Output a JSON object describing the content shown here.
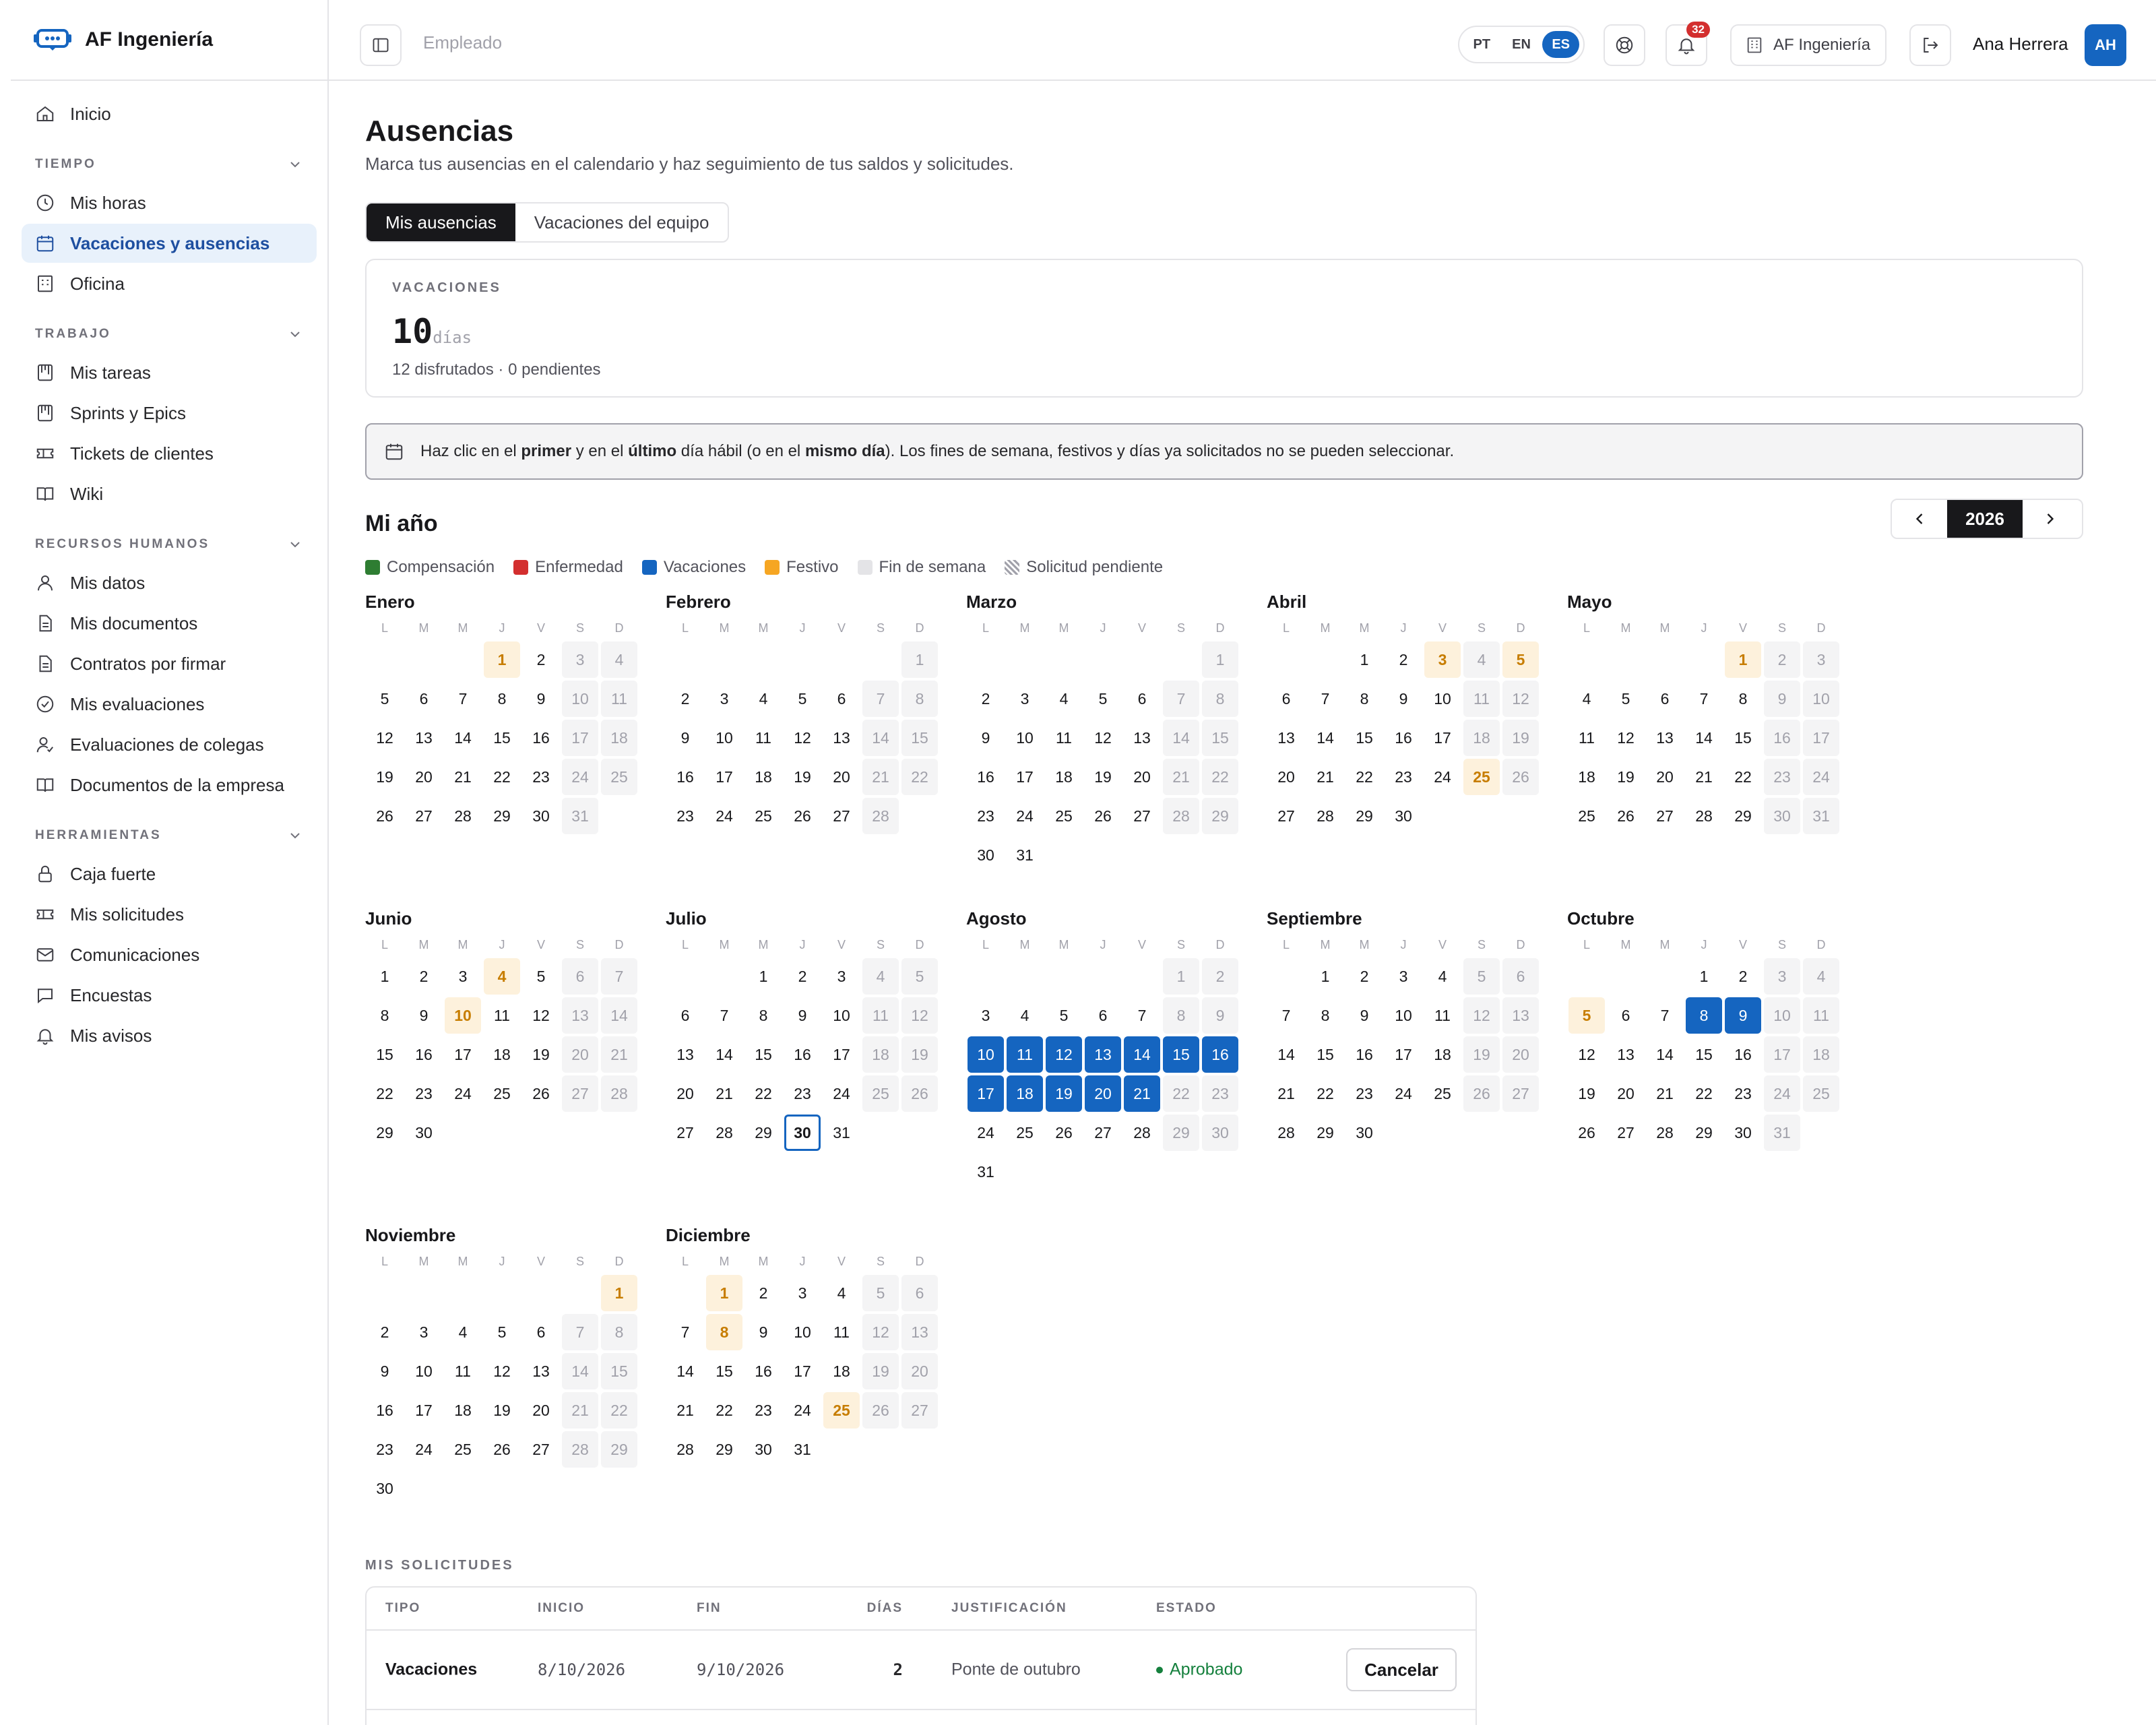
{
  "app": {
    "brand": "AF Ingeniería"
  },
  "sidebar": {
    "home": "Inicio",
    "sections": [
      {
        "title": "TIEMPO",
        "items": [
          "Mis horas",
          "Vacaciones y ausencias",
          "Oficina"
        ]
      },
      {
        "title": "TRABAJO",
        "items": [
          "Mis tareas",
          "Sprints y Epics",
          "Tickets de clientes",
          "Wiki"
        ]
      },
      {
        "title": "RECURSOS HUMANOS",
        "items": [
          "Mis datos",
          "Mis documentos",
          "Contratos por firmar",
          "Mis evaluaciones",
          "Evaluaciones de colegas",
          "Documentos de la empresa"
        ]
      },
      {
        "title": "HERRAMIENTAS",
        "items": [
          "Caja fuerte",
          "Mis solicitudes",
          "Comunicaciones",
          "Encuestas",
          "Mis avisos"
        ]
      }
    ],
    "active": "Vacaciones y ausencias"
  },
  "topbar": {
    "role": "Empleado",
    "langs": [
      "PT",
      "EN",
      "ES"
    ],
    "active_lang": "ES",
    "notifications": "32",
    "org": "AF Ingeniería",
    "user": "Ana Herrera",
    "initials": "AH"
  },
  "page": {
    "title": "Ausencias",
    "subtitle": "Marca tus ausencias en el calendario y haz seguimiento de tus saldos y solicitudes.",
    "tabs": [
      "Mis ausencias",
      "Vacaciones del equipo"
    ],
    "balance": {
      "label": "VACACIONES",
      "value": "10",
      "unit": "días",
      "detail": "12 disfrutados · 0 pendientes"
    },
    "info": {
      "p1": "Haz clic en el ",
      "b1": "primer",
      "p2": " y en el ",
      "b2": "último",
      "p3": " día hábil (o en el ",
      "b3": "mismo día",
      "p4": "). Los fines de semana, festivos y días ya solicitados no se pueden seleccionar."
    },
    "year_title": "Mi año",
    "year": "2026"
  },
  "legend": [
    {
      "label": "Compensación",
      "color": "#2e7d32"
    },
    {
      "label": "Enfermedad",
      "color": "#d32f2f"
    },
    {
      "label": "Vacaciones",
      "color": "#1565c0"
    },
    {
      "label": "Festivo",
      "color": "#f6a623"
    },
    {
      "label": "Fin de semana",
      "color": "#e4e4e7"
    },
    {
      "label": "Solicitud pendiente",
      "color": "striped"
    }
  ],
  "weekday_headers": [
    "L",
    "M",
    "M",
    "J",
    "V",
    "S",
    "D"
  ],
  "calendar": {
    "months": [
      {
        "name": "Enero",
        "offset": 3,
        "days": 31,
        "holidays": [
          1
        ],
        "vacation": []
      },
      {
        "name": "Febrero",
        "offset": 6,
        "days": 28,
        "holidays": [],
        "vacation": []
      },
      {
        "name": "Marzo",
        "offset": 6,
        "days": 31,
        "holidays": [],
        "vacation": []
      },
      {
        "name": "Abril",
        "offset": 2,
        "days": 30,
        "holidays": [
          3,
          5,
          25
        ],
        "vacation": []
      },
      {
        "name": "Mayo",
        "offset": 4,
        "days": 31,
        "holidays": [
          1
        ],
        "vacation": []
      },
      {
        "name": "Junio",
        "offset": 0,
        "days": 30,
        "holidays": [
          4,
          10
        ],
        "vacation": []
      },
      {
        "name": "Julio",
        "offset": 2,
        "days": 31,
        "holidays": [],
        "vacation": [],
        "today": 30
      },
      {
        "name": "Agosto",
        "offset": 5,
        "days": 31,
        "holidays": [],
        "vacation": [
          10,
          11,
          12,
          13,
          14,
          15,
          16,
          17,
          18,
          19,
          20,
          21
        ]
      },
      {
        "name": "Septiembre",
        "offset": 1,
        "days": 30,
        "holidays": [],
        "vacation": []
      },
      {
        "name": "Octubre",
        "offset": 3,
        "days": 31,
        "holidays": [
          5
        ],
        "vacation": [
          8,
          9
        ]
      },
      {
        "name": "Noviembre",
        "offset": 6,
        "days": 30,
        "holidays": [
          1
        ],
        "vacation": []
      },
      {
        "name": "Diciembre",
        "offset": 1,
        "days": 31,
        "holidays": [
          1,
          8,
          25
        ],
        "vacation": []
      }
    ]
  },
  "requests": {
    "label": "MIS SOLICITUDES",
    "headers": [
      "TIPO",
      "INICIO",
      "FIN",
      "DÍAS",
      "JUSTIFICACIÓN",
      "ESTADO"
    ],
    "rows": [
      {
        "type": "Vacaciones",
        "start": "8/10/2026",
        "end": "9/10/2026",
        "days": "2",
        "justification": "Ponte de outubro",
        "status": "Aprobado",
        "action": "Cancelar"
      }
    ]
  }
}
